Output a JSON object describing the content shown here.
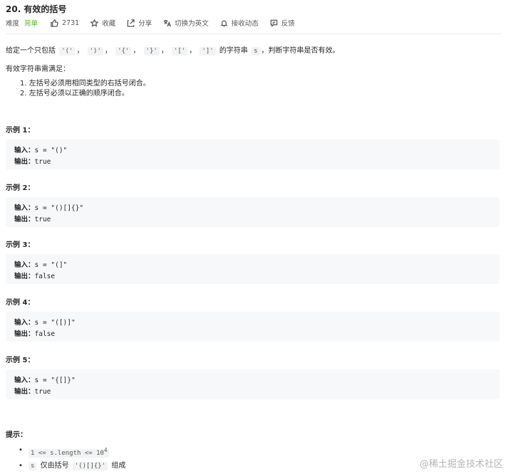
{
  "problem": {
    "title": "20. 有效的括号",
    "difficulty_label": "难度",
    "difficulty": "简单",
    "likes": "2731",
    "collect": "收藏",
    "share": "分享",
    "switch_lang": "切换为英文",
    "notify": "接收动态",
    "feedback": "反馈"
  },
  "description": {
    "prefix": "给定一个只包括",
    "chars": [
      "'('",
      "')'",
      "'{'",
      "'}'",
      "'['",
      "']'"
    ],
    "sep": "，",
    "middle": "的字符串",
    "var": "s",
    "suffix": "，判断字符串是否有效。",
    "requirement": "有效字符串需满足：",
    "rules": [
      "1. 左括号必须用相同类型的右括号闭合。",
      "2. 左括号必须以正确的顺序闭合。"
    ]
  },
  "examples": [
    {
      "title": "示例 1：",
      "input_label": "输入：",
      "input": "s = \"()\"",
      "output_label": "输出：",
      "output": "true"
    },
    {
      "title": "示例 2：",
      "input_label": "输入：",
      "input": "s = \"()[]{}\"",
      "output_label": "输出：",
      "output": "true"
    },
    {
      "title": "示例 3：",
      "input_label": "输入：",
      "input": "s = \"(]\"",
      "output_label": "输出：",
      "output": "false"
    },
    {
      "title": "示例 4：",
      "input_label": "输入：",
      "input": "s = \"([)]\"",
      "output_label": "输出：",
      "output": "false"
    },
    {
      "title": "示例 5：",
      "input_label": "输入：",
      "input": "s = \"{[]}\"",
      "output_label": "输出：",
      "output": "true"
    }
  ],
  "hints": {
    "title": "提示：",
    "h1_code": "1 <= s.length <= 10",
    "h1_sup": "4",
    "h2_var": "s",
    "h2_text1": "仅由括号",
    "h2_code": "'()[]{}'",
    "h2_text2": "组成"
  },
  "watermark": "@稀土掘金技术社区",
  "icons": [
    "thumb-up-icon",
    "star-icon",
    "share-icon",
    "translate-icon",
    "bell-icon",
    "feedback-icon"
  ]
}
